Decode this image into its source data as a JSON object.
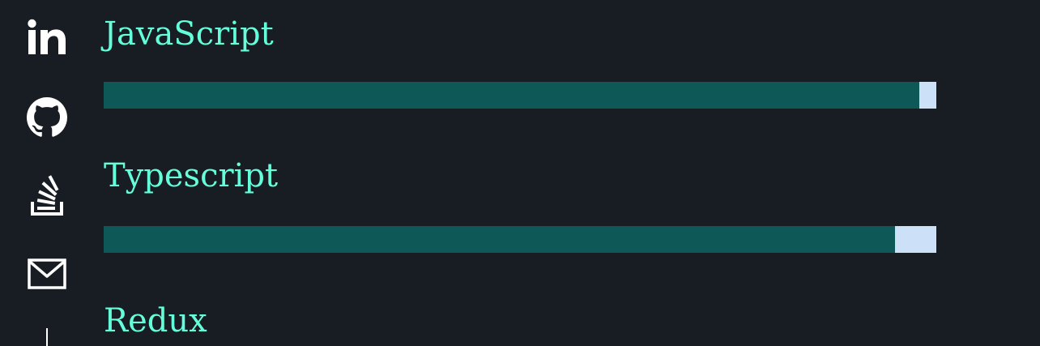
{
  "social": {
    "items": [
      {
        "name": "linkedin",
        "icon": "linkedin-icon"
      },
      {
        "name": "github",
        "icon": "github-icon"
      },
      {
        "name": "stackoverflow",
        "icon": "stackoverflow-icon"
      },
      {
        "name": "email",
        "icon": "mail-icon"
      }
    ],
    "icon_color": "#ffffff"
  },
  "skills": [
    {
      "name": "JavaScript",
      "level": 0.98
    },
    {
      "name": "Typescript",
      "level": 0.95
    },
    {
      "name": "Redux"
    }
  ],
  "colors": {
    "background": "#181c23",
    "accent_text": "#64ffda",
    "bar_fill": "#0f5858",
    "bar_track": "#cce0f7"
  }
}
